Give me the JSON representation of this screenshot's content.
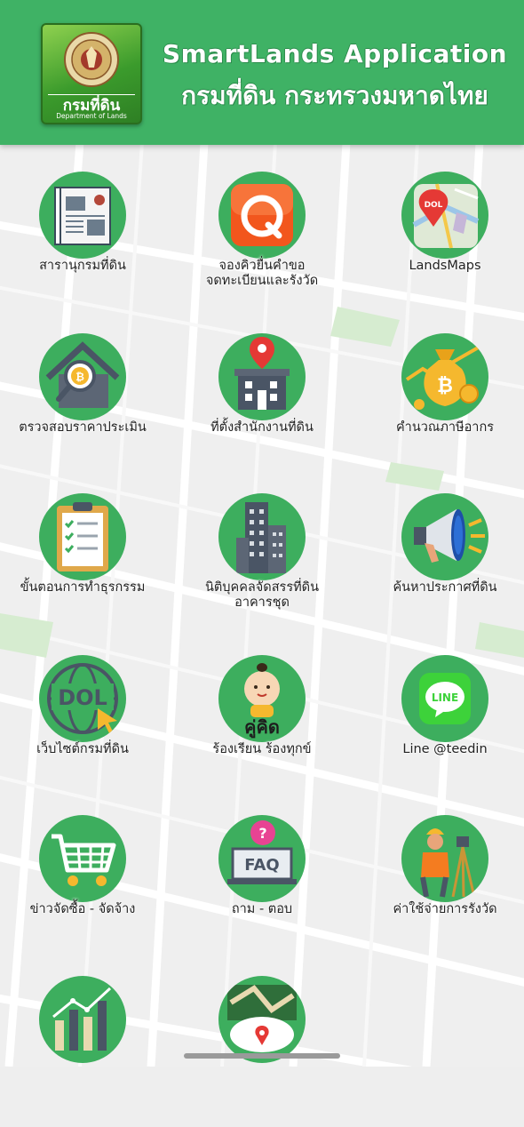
{
  "header": {
    "logo_thai": "กรมที่ดิน",
    "logo_english": "Department of Lands",
    "title_line1": "SmartLands Application",
    "title_line2": "กรมที่ดิน กระทรวงมหาดไทย"
  },
  "colors": {
    "header_bg": "#3fb265",
    "tile_circle": "#3dae5e",
    "label_text": "#222222"
  },
  "menu": [
    {
      "label": "สารานุกรมที่ดิน",
      "icon": "newspaper-icon"
    },
    {
      "label": "จองคิวยื่นคำขอ\nจดทะเบียนและรังวัด",
      "icon": "queue-app-icon"
    },
    {
      "label": "LandsMaps",
      "icon": "map-pin-icon"
    },
    {
      "label": "ตรวจสอบราคาประเมิน",
      "icon": "house-price-icon"
    },
    {
      "label": "ที่ตั้งสำนักงานที่ดิน",
      "icon": "office-location-icon"
    },
    {
      "label": "คำนวณภาษีอากร",
      "icon": "money-bag-icon"
    },
    {
      "label": "ขั้นตอนการทำธุรกรรม",
      "icon": "clipboard-checklist-icon"
    },
    {
      "label": "นิติบุคคลจัดสรรที่ดิน\nอาคารชุด",
      "icon": "building-icon"
    },
    {
      "label": "ค้นหาประกาศที่ดิน",
      "icon": "megaphone-icon"
    },
    {
      "label": "เว็บไซต์กรมที่ดิน",
      "icon": "dol-globe-icon"
    },
    {
      "label": "ร้องเรียน ร้องทุกข์",
      "icon": "khukhit-mascot-icon"
    },
    {
      "label": "Line @teedin",
      "icon": "line-icon"
    },
    {
      "label": "ข่าวจัดซื้อ - จัดจ้าง",
      "icon": "shopping-cart-icon"
    },
    {
      "label": "ถาม - ตอบ",
      "icon": "faq-icon"
    },
    {
      "label": "ค่าใช้จ่ายการรังวัด",
      "icon": "surveyor-icon"
    },
    {
      "label": "",
      "icon": "bar-chart-icon"
    },
    {
      "label": "",
      "icon": "land-map-icon"
    }
  ]
}
